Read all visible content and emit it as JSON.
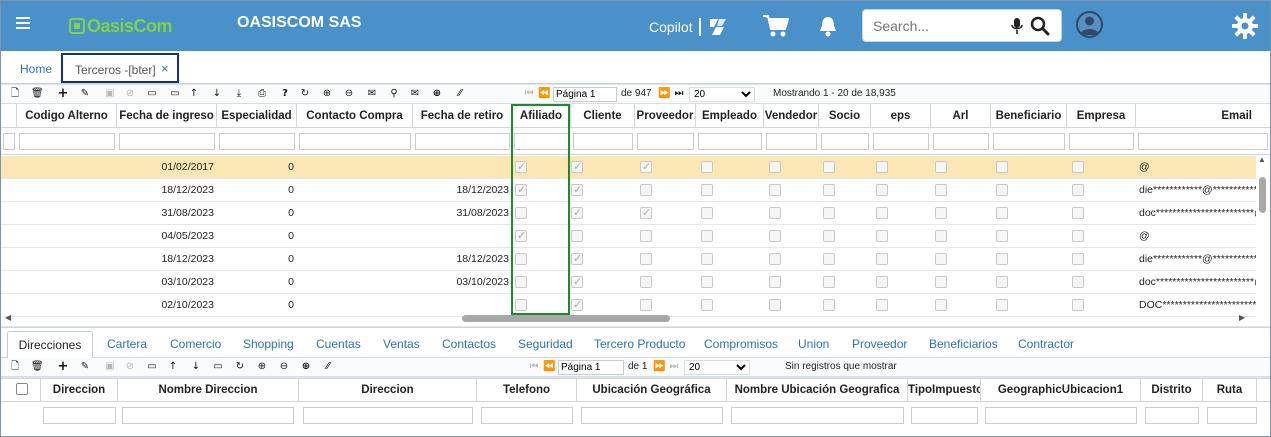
{
  "header": {
    "logo_text": "OasisCom",
    "company": "OASISCOM SAS",
    "copilot_label": "Copilot",
    "search_placeholder": "Search...",
    "color_primary": "#4a90c9",
    "logo_color": "#7fd34a"
  },
  "tabs": [
    {
      "label": "Home"
    },
    {
      "label": "Terceros -[bter]",
      "close": "×"
    }
  ],
  "toolbar": {
    "page_label": "Página 1",
    "of_label": "de 947",
    "page_size": "20",
    "showing": "Mostrando 1 - 20 de 18,935"
  },
  "grid": {
    "columns": [
      "Codigo Alterno",
      "Fecha de ingreso",
      "Especialidad",
      "Contacto Compra",
      "Fecha de retiro",
      "Afiliado",
      "Cliente",
      "Proveedor",
      "Empleado",
      "Vendedor",
      "Socio",
      "eps",
      "Arl",
      "Beneficiario",
      "Empresa",
      "Email"
    ],
    "rows": [
      {
        "fecha_ingreso": "01/02/2017",
        "especialidad": "0",
        "fecha_retiro": "",
        "afiliado": true,
        "cliente": true,
        "proveedor": true,
        "email": "@"
      },
      {
        "fecha_ingreso": "18/12/2023",
        "especialidad": "0",
        "fecha_retiro": "18/12/2023",
        "afiliado": true,
        "cliente": true,
        "proveedor": false,
        "email": "die************@***************"
      },
      {
        "fecha_ingreso": "31/08/2023",
        "especialidad": "0",
        "fecha_retiro": "31/08/2023",
        "afiliado": false,
        "cliente": true,
        "proveedor": true,
        "email": "doc************************@***"
      },
      {
        "fecha_ingreso": "04/05/2023",
        "especialidad": "0",
        "fecha_retiro": "",
        "afiliado": true,
        "cliente": false,
        "proveedor": false,
        "email": "@"
      },
      {
        "fecha_ingreso": "18/12/2023",
        "especialidad": "0",
        "fecha_retiro": "18/12/2023",
        "afiliado": false,
        "cliente": true,
        "proveedor": false,
        "email": "die************@***************"
      },
      {
        "fecha_ingreso": "03/10/2023",
        "especialidad": "0",
        "fecha_retiro": "03/10/2023",
        "afiliado": false,
        "cliente": true,
        "proveedor": false,
        "email": "doc************************@***"
      },
      {
        "fecha_ingreso": "02/10/2023",
        "especialidad": "0",
        "fecha_retiro": "",
        "afiliado": false,
        "cliente": true,
        "proveedor": false,
        "email": "DOC************************@"
      }
    ],
    "highlight_color": "#1f8a2d",
    "selected_row_color": "#fbe7b3"
  },
  "bottom_tabs": [
    "Direcciones",
    "Cartera",
    "Comercio",
    "Shopping",
    "Cuentas",
    "Ventas",
    "Contactos",
    "Seguridad",
    "Tercero Producto",
    "Compromisos",
    "Union",
    "Proveedor",
    "Beneficiarios",
    "Contractor"
  ],
  "bottom_toolbar": {
    "page_label": "Página 1",
    "of_label": "de 1",
    "page_size": "20",
    "no_records": "Sin registros que mostrar"
  },
  "bottom_grid": {
    "columns": [
      "Direccion",
      "Nombre Direccion",
      "Direccion",
      "Telefono",
      "Ubicación Geográfica",
      "Nombre Ubicación Geografica",
      "TipoImpuesto",
      "GeographicUbicacion1",
      "Distrito",
      "Ruta"
    ]
  }
}
